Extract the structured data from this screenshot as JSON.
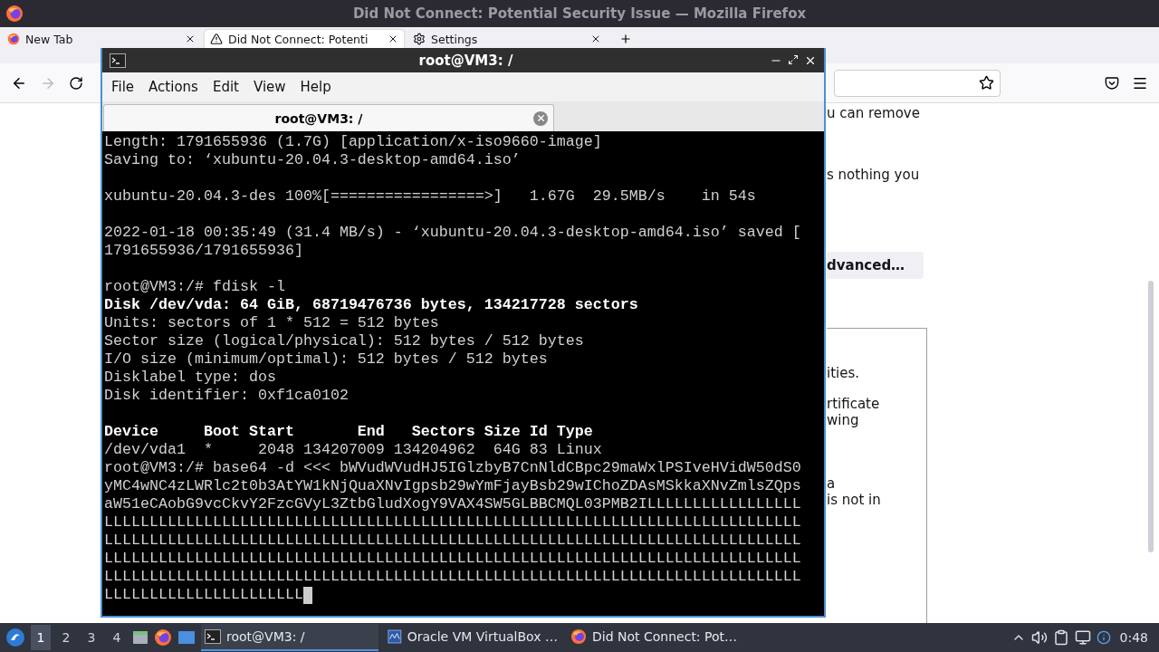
{
  "firefox": {
    "title": "Did Not Connect: Potential Security Issue — Mozilla Firefox",
    "tabs": [
      {
        "label": "New Tab",
        "selected": false
      },
      {
        "label": "Did Not Connect: Potenti",
        "selected": true
      },
      {
        "label": "Settings",
        "selected": false
      }
    ],
    "nav": {
      "forward_disabled": true
    },
    "page": {
      "paragraphs": [
        "u can remove",
        "s nothing you"
      ],
      "advanced_button": "dvanced…",
      "details": [
        {
          "lines": [
            "ities."
          ]
        },
        {
          "lines": [
            "rtificate",
            "wing"
          ]
        },
        {
          "lines": [
            "a",
            "is not in"
          ]
        }
      ]
    }
  },
  "terminal": {
    "title": "root@VM3: /",
    "menu": [
      "File",
      "Actions",
      "Edit",
      "View",
      "Help"
    ],
    "tab": {
      "label": "root@VM3: /",
      "selected": true
    },
    "lines": [
      {
        "kind": "text",
        "bold": false,
        "text": "Length: 1791655936 (1.7G) [application/x-iso9660-image]"
      },
      {
        "kind": "text",
        "bold": false,
        "text": "Saving to: ‘xubuntu-20.04.3-desktop-amd64.iso’"
      },
      {
        "kind": "blank"
      },
      {
        "kind": "text",
        "bold": false,
        "text": "xubuntu-20.04.3-des 100%[=================>]   1.67G  29.5MB/s    in 54s"
      },
      {
        "kind": "blank"
      },
      {
        "kind": "text",
        "bold": false,
        "text": "2022-01-18 00:35:49 (31.4 MB/s) - ‘xubuntu-20.04.3-desktop-amd64.iso’ saved ["
      },
      {
        "kind": "text",
        "bold": false,
        "text": "1791655936/1791655936]"
      },
      {
        "kind": "blank"
      },
      {
        "kind": "text",
        "bold": false,
        "text": "root@VM3:/# fdisk -l"
      },
      {
        "kind": "text",
        "bold": true,
        "text": "Disk /dev/vda: 64 GiB, 68719476736 bytes, 134217728 sectors"
      },
      {
        "kind": "text",
        "bold": false,
        "text": "Units: sectors of 1 * 512 = 512 bytes"
      },
      {
        "kind": "text",
        "bold": false,
        "text": "Sector size (logical/physical): 512 bytes / 512 bytes"
      },
      {
        "kind": "text",
        "bold": false,
        "text": "I/O size (minimum/optimal): 512 bytes / 512 bytes"
      },
      {
        "kind": "text",
        "bold": false,
        "text": "Disklabel type: dos"
      },
      {
        "kind": "text",
        "bold": false,
        "text": "Disk identifier: 0xf1ca0102"
      },
      {
        "kind": "blank"
      },
      {
        "kind": "text",
        "bold": true,
        "text": "Device     Boot Start       End   Sectors Size Id Type"
      },
      {
        "kind": "text",
        "bold": false,
        "text": "/dev/vda1  *     2048 134207009 134204962  64G 83 Linux"
      },
      {
        "kind": "text",
        "bold": false,
        "text": "root@VM3:/# base64 -d <<< bWVudWVudHJ5IGlzbyB7CnNldCBpc29maWxlPSIveHVidW50dS0"
      },
      {
        "kind": "text",
        "bold": false,
        "text": "yMC4wNC4zLWRlc2t0b3AtYW1kNjQuaXNvIgpsb29wYmFjayBsb29wIChoZDAsMSkkaXNvZmlsZQps"
      },
      {
        "kind": "text",
        "bold": false,
        "text": "aW51eCAobG9vcCkvY2FzcGVyL3ZtbGludXogY9VAX4SW5GLBBCMQL03PMB2ILLLLLLLLLLLLLLLLL"
      },
      {
        "kind": "text",
        "bold": false,
        "text": "LLLLLLLLLLLLLLLLLLLLLLLLLLLLLLLLLLLLLLLLLLLLLLLLLLLLLLLLLLLLLLLLLLLLLLLLLLLLL"
      },
      {
        "kind": "text",
        "bold": false,
        "text": "LLLLLLLLLLLLLLLLLLLLLLLLLLLLLLLLLLLLLLLLLLLLLLLLLLLLLLLLLLLLLLLLLLLLLLLLLLLLL"
      },
      {
        "kind": "text",
        "bold": false,
        "text": "LLLLLLLLLLLLLLLLLLLLLLLLLLLLLLLLLLLLLLLLLLLLLLLLLLLLLLLLLLLLLLLLLLLLLLLLLLLLL"
      },
      {
        "kind": "text",
        "bold": false,
        "text": "LLLLLLLLLLLLLLLLLLLLLLLLLLLLLLLLLLLLLLLLLLLLLLLLLLLLLLLLLLLLLLLLLLLLLLLLLLLLL"
      },
      {
        "kind": "prompt",
        "bold": false,
        "text": "LLLLLLLLLLLLLLLLLLLLLL"
      }
    ]
  },
  "taskbar": {
    "workspaces": [
      {
        "label": "1",
        "selected": true
      },
      {
        "label": "2",
        "selected": false
      },
      {
        "label": "3",
        "selected": false
      },
      {
        "label": "4",
        "selected": false
      }
    ],
    "tasks": [
      {
        "label": "root@VM3: /",
        "selected": true
      },
      {
        "label": "Oracle VM VirtualBox …",
        "selected": false
      },
      {
        "label": "Did Not Connect: Pot…",
        "selected": false
      }
    ],
    "clock": "0:48"
  }
}
